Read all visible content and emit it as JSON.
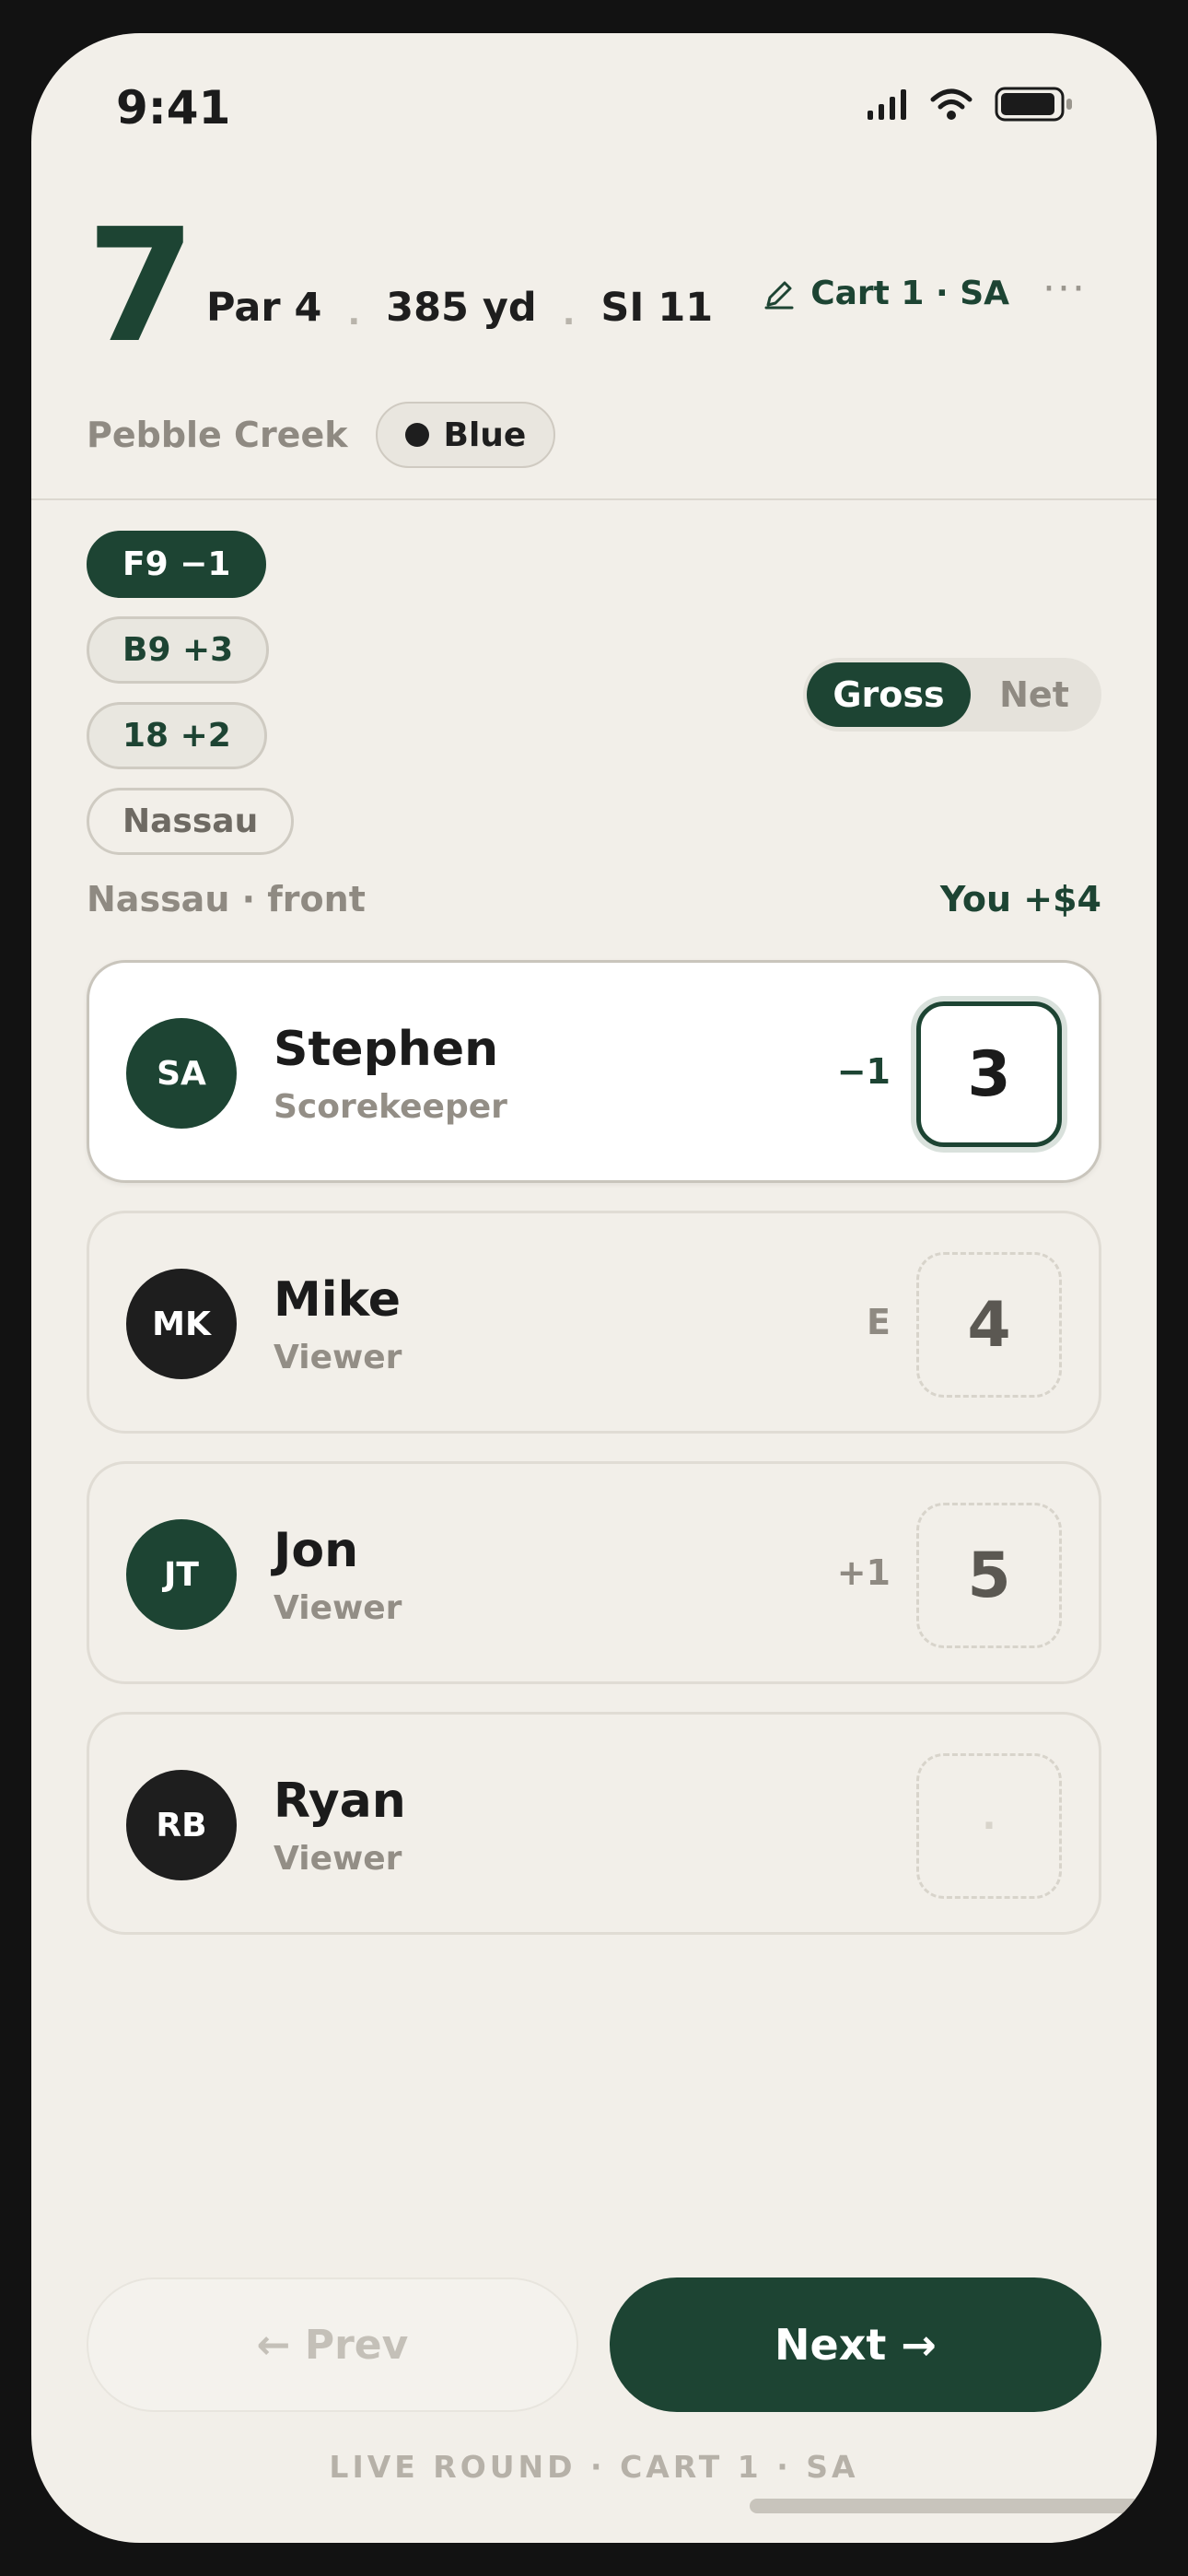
{
  "status_bar": {
    "time": "9:41",
    "icons": [
      "signal-icon",
      "wifi-icon",
      "battery-icon"
    ]
  },
  "hole": {
    "number": "7",
    "par": "Par 4",
    "yardage": "385 yd",
    "stroke_index": "SI 11",
    "separator": "."
  },
  "cart": {
    "label": "Cart 1 · SA",
    "icon": "pencil-icon"
  },
  "more": {
    "label": "···"
  },
  "course": {
    "name": "Pebble Creek",
    "tee": "Blue"
  },
  "match_chips": [
    {
      "label": "F9 −1",
      "state": "active"
    },
    {
      "label": "B9 +3",
      "state": "default"
    },
    {
      "label": "18 +2",
      "state": "default"
    },
    {
      "label": "Nassau",
      "state": "plain"
    }
  ],
  "scoring_toggle": {
    "options": [
      "Gross",
      "Net"
    ],
    "selected": "Gross"
  },
  "game": {
    "label": "Nassau · front",
    "result": "You +$4"
  },
  "players": [
    {
      "initials": "SA",
      "name": "Stephen",
      "role": "Scorekeeper",
      "to_par": "−1",
      "score": "3",
      "selected": true
    },
    {
      "initials": "MK",
      "name": "Mike",
      "role": "Viewer",
      "to_par": "E",
      "score": "4",
      "selected": false
    },
    {
      "initials": "JT",
      "name": "Jon",
      "role": "Viewer",
      "to_par": "+1",
      "score": "5",
      "selected": false
    },
    {
      "initials": "RB",
      "name": "Ryan",
      "role": "Viewer",
      "to_par": "",
      "score": "·",
      "selected": false
    }
  ],
  "nav": {
    "prev_label": "← Prev",
    "next_label": "Next →"
  },
  "footer": {
    "label": "LIVE ROUND · CART 1 · SA"
  },
  "colors": {
    "brand_green": "#1d4433",
    "background": "#f2efe9",
    "muted_text": "#8f8a82"
  }
}
